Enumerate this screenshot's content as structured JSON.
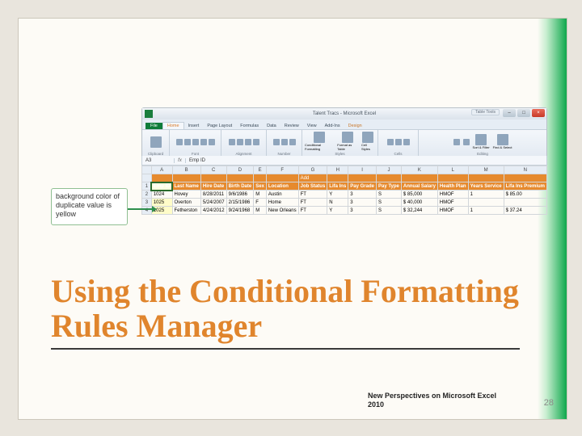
{
  "slide": {
    "title": "Using the Conditional Formatting Rules Manager",
    "footer": "New Perspectives on Microsoft Excel 2010",
    "page_number": "28"
  },
  "callout": {
    "text": "background color of duplicate value is yellow"
  },
  "excel": {
    "app_title": "Talent Tracs - Microsoft Excel",
    "context_tab": "Table Tools",
    "window_buttons": {
      "min": "–",
      "max": "□",
      "close": "×"
    },
    "file_tab": "File",
    "tabs": [
      "Home",
      "Insert",
      "Page Layout",
      "Formulas",
      "Data",
      "Review",
      "View",
      "Add-Ins",
      "Design"
    ],
    "active_tab": "Home",
    "ribbon_groups": [
      "Clipboard",
      "Font",
      "Alignment",
      "Number",
      "Styles",
      "Cells",
      "Editing"
    ],
    "styles_items": [
      "Conditional Formatting",
      "Format as Table",
      "Cell Styles"
    ],
    "editing_items": [
      "Sort & Filter",
      "Find & Select"
    ],
    "name_box": "A3",
    "fx_value": "Emp ID",
    "columns": [
      "A",
      "B",
      "C",
      "D",
      "E",
      "F",
      "G",
      "H",
      "I",
      "J",
      "K",
      "L",
      "M",
      "N"
    ],
    "header_top": [
      "",
      "",
      "",
      "",
      "",
      "",
      "Add",
      "",
      "",
      "",
      "",
      "",
      "",
      ""
    ],
    "header": [
      "Emp ID",
      "Last Name",
      "Hire Date",
      "Birth Date",
      "Sex",
      "Location",
      "Job Status",
      "Lifa Ins",
      "Pay Grade",
      "Pay Type",
      "Annual Salary",
      "Health Plan",
      "Years Service",
      "Lifa Ins Premium"
    ],
    "rows": [
      {
        "n": "2",
        "cells": [
          "1024",
          "Hovey",
          "8/28/2011",
          "9/6/1986",
          "M",
          "Austin",
          "FT",
          "Y",
          "3",
          "S",
          "$ 85,000",
          "HMOF",
          "1",
          "$ 85.00"
        ]
      },
      {
        "n": "3",
        "cells": [
          "1025",
          "Overton",
          "5/24/2007",
          "2/15/1986",
          "F",
          "Home",
          "FT",
          "N",
          "3",
          "S",
          "$ 40,000",
          "HMOF",
          "",
          ""
        ]
      },
      {
        "n": "4",
        "cells": [
          "1025",
          "Fetherston",
          "4/24/2012",
          "9/24/1968",
          "M",
          "New Orleans",
          "FT",
          "Y",
          "3",
          "S",
          "$ 32,244",
          "HMOF",
          "1",
          "$ 37.24"
        ]
      }
    ],
    "row_head_first": "1",
    "duplicate_emp_id": "1025"
  }
}
